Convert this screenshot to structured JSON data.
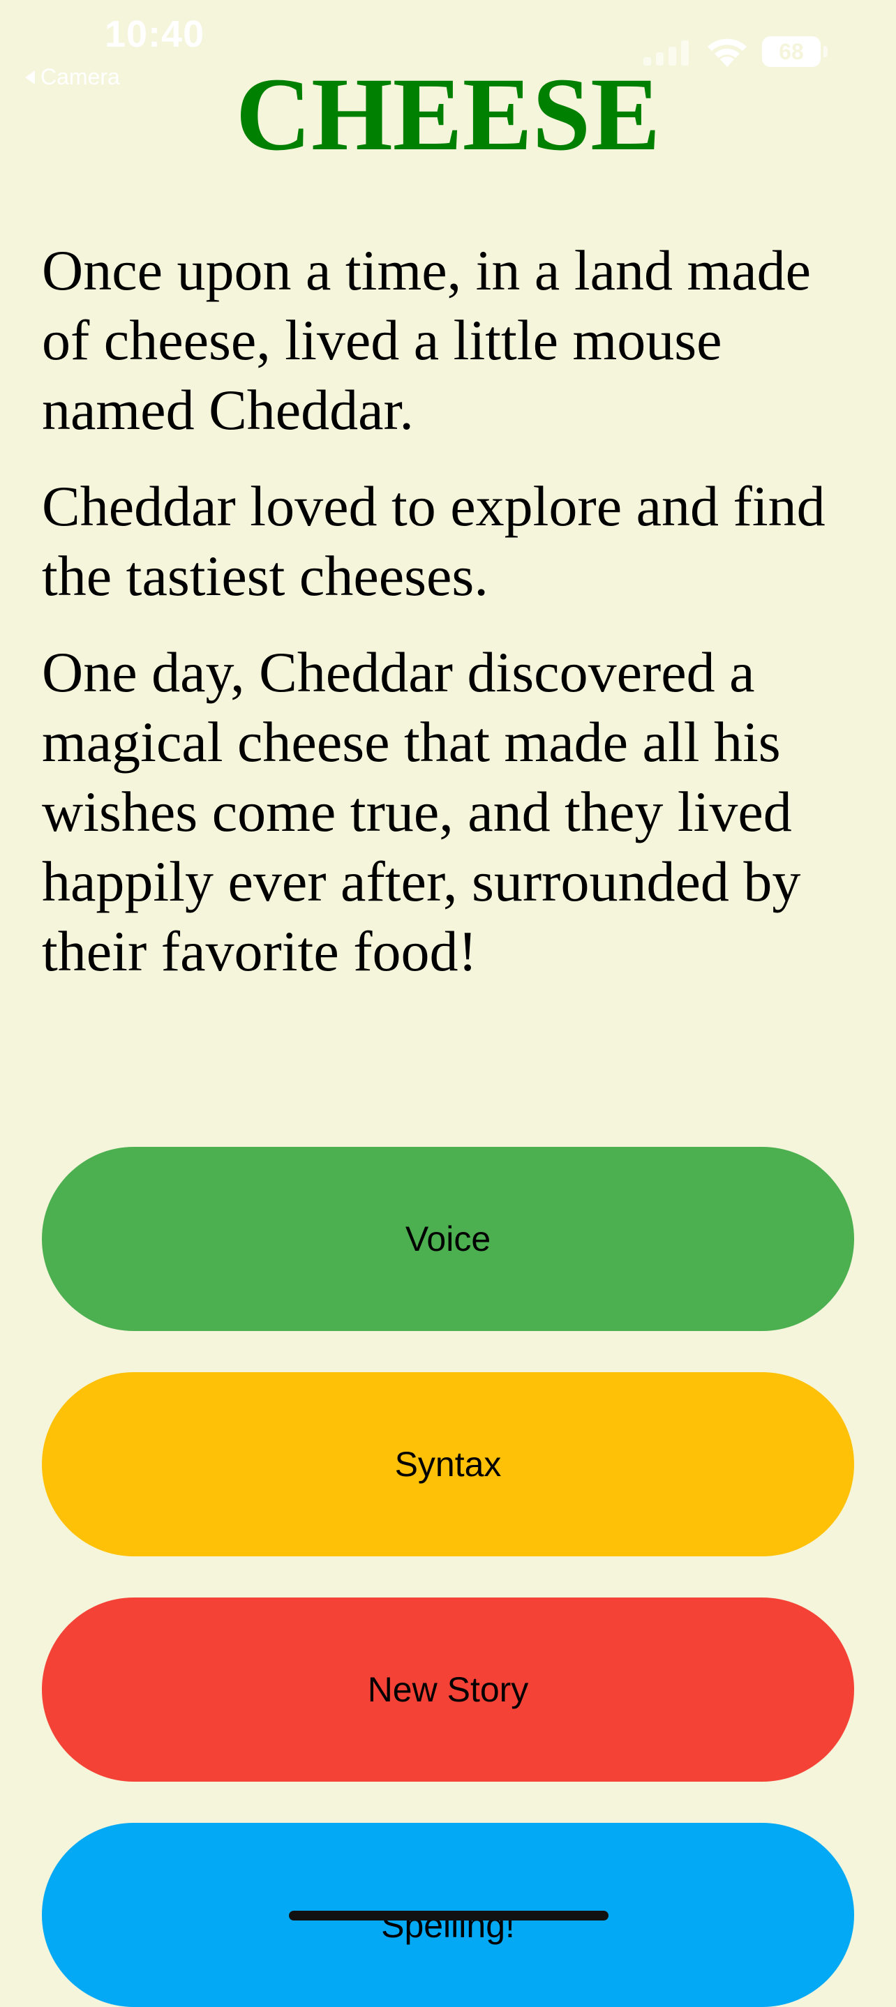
{
  "status_bar": {
    "time": "10:40",
    "back_app": "Camera",
    "battery_level": "68",
    "icons": [
      "signal-icon",
      "wifi-icon",
      "battery-icon"
    ]
  },
  "title": "CHEESE",
  "story": {
    "paragraphs": [
      "Once upon a time, in a land made of cheese, lived a little mouse named Cheddar.",
      "Cheddar loved to explore and find the tastiest cheeses.",
      "One day, Cheddar discovered a magical cheese that made all his wishes come true, and they lived happily ever after, surrounded by their favorite food!"
    ]
  },
  "buttons": {
    "voice": "Voice",
    "syntax": "Syntax",
    "new_story": "New Story",
    "spelling": "Spelling!"
  },
  "colors": {
    "background": "#f5f5dc",
    "title": "#008000",
    "voice": "#4caf50",
    "syntax": "#ffc107",
    "new_story": "#f44336",
    "spelling": "#03a9f4"
  }
}
